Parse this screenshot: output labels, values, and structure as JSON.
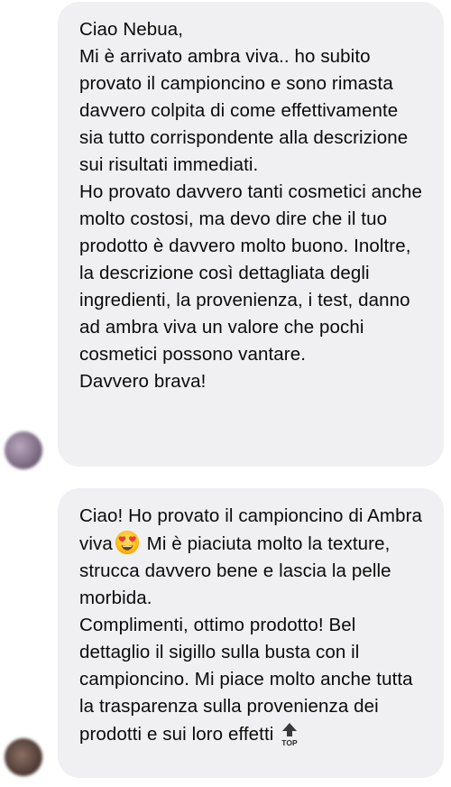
{
  "messages": [
    {
      "paragraphs": [
        "Ciao Nebua,",
        "Mi è arrivato ambra viva.. ho subito provato il campioncino e sono rimasta davvero colpita di come effettivamente sia tutto corrispondente alla descrizione sui risultati immediati.",
        "Ho provato davvero tanti cosmetici anche molto costosi, ma devo dire che il tuo prodotto è davvero molto buono. Inoltre, la descrizione così dettagliata degli ingredienti, la provenienza, i test, danno ad ambra viva un valore che pochi cosmetici possono vantare.",
        "Davvero brava!"
      ]
    },
    {
      "p1_before_emoji": "Ciao! Ho provato il campioncino di Ambra viva",
      "emoji": "heart-eyes-emoji",
      "p1_after_emoji": " Mi è piaciuta molto la texture, strucca davvero bene e lascia la pelle morbida.",
      "p2": "Complimenti, ottimo prodotto! Bel dettaglio il sigillo sulla busta con il campioncino. Mi piace molto anche tutta la trasparenza sulla provenienza dei prodotti e sui loro effetti",
      "top_icon_label": "TOP"
    }
  ],
  "colors": {
    "bubble": "#f0f0f2",
    "text": "#0a0a0a"
  }
}
